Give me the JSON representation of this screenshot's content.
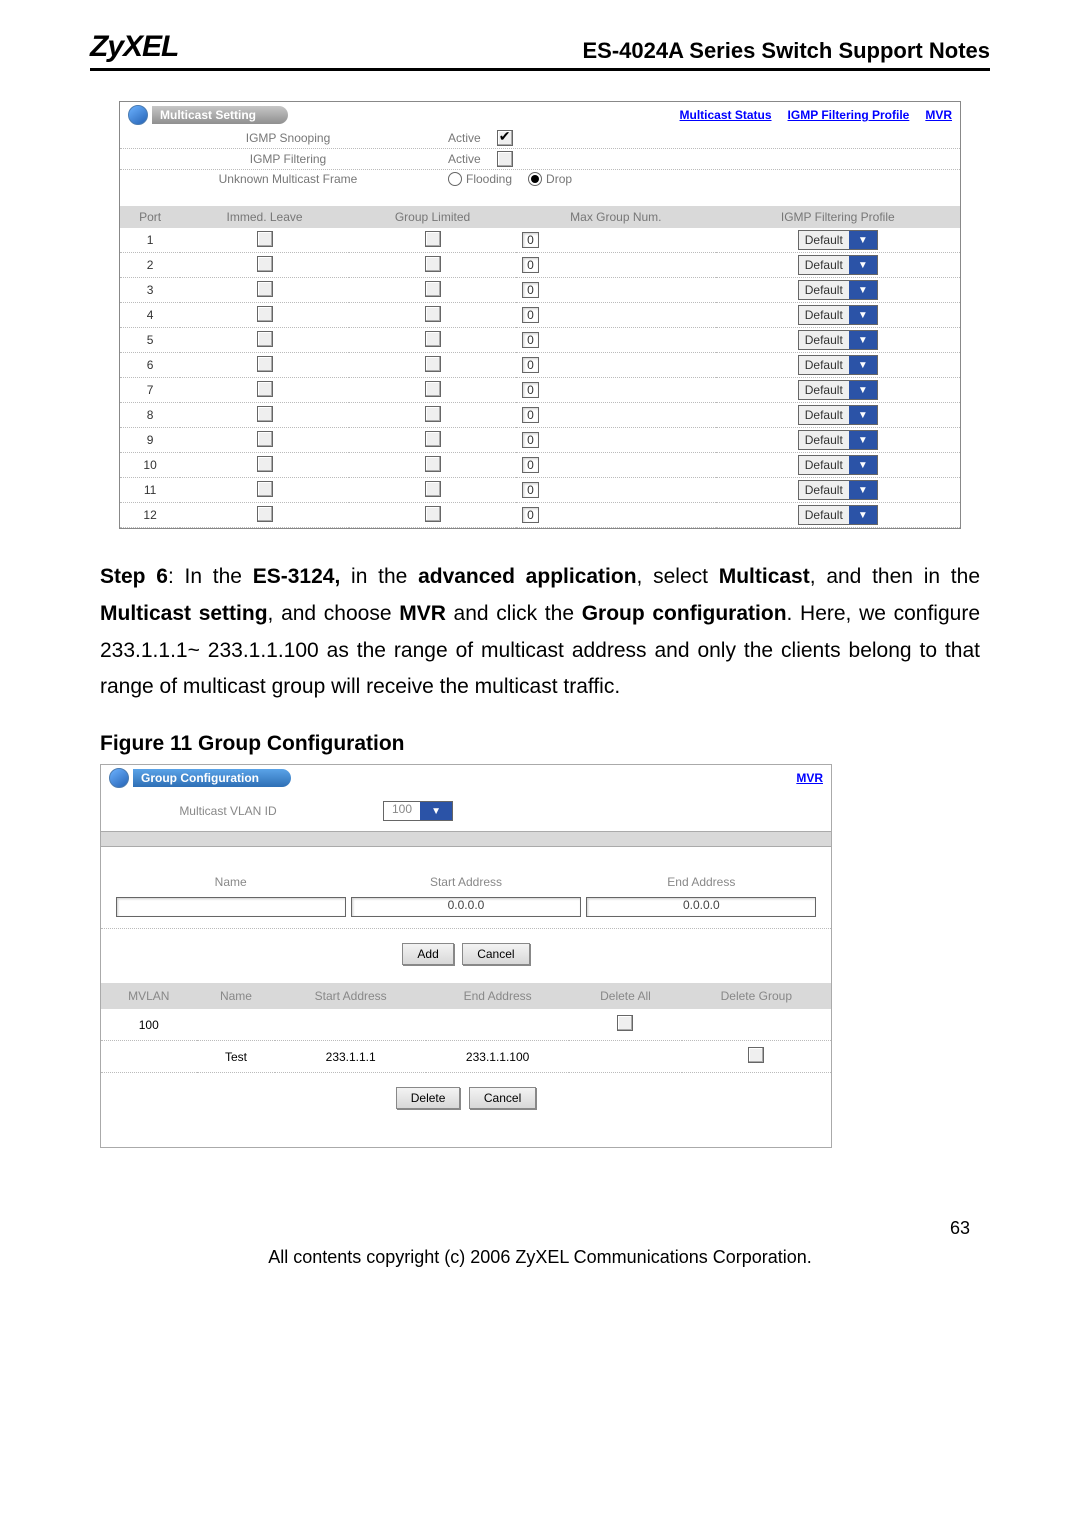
{
  "header": {
    "brand": "ZyXEL",
    "title": "ES-4024A Series Switch Support Notes"
  },
  "panel1": {
    "title": "Multicast Setting",
    "links": {
      "status": "Multicast Status",
      "profile": "IGMP Filtering Profile",
      "mvr": "MVR"
    },
    "rows": {
      "igmp_snooping": {
        "label": "IGMP Snooping",
        "field": "Active"
      },
      "igmp_filtering": {
        "label": "IGMP Filtering",
        "field": "Active"
      },
      "unknown_frame": {
        "label": "Unknown Multicast Frame",
        "opt1": "Flooding",
        "opt2": "Drop"
      }
    },
    "table": {
      "headers": {
        "port": "Port",
        "immed": "Immed. Leave",
        "group": "Group Limited",
        "max": "Max Group Num.",
        "profile": "IGMP Filtering Profile"
      },
      "rows": [
        {
          "port": "1",
          "max": "0",
          "profile": "Default"
        },
        {
          "port": "2",
          "max": "0",
          "profile": "Default"
        },
        {
          "port": "3",
          "max": "0",
          "profile": "Default"
        },
        {
          "port": "4",
          "max": "0",
          "profile": "Default"
        },
        {
          "port": "5",
          "max": "0",
          "profile": "Default"
        },
        {
          "port": "6",
          "max": "0",
          "profile": "Default"
        },
        {
          "port": "7",
          "max": "0",
          "profile": "Default"
        },
        {
          "port": "8",
          "max": "0",
          "profile": "Default"
        },
        {
          "port": "9",
          "max": "0",
          "profile": "Default"
        },
        {
          "port": "10",
          "max": "0",
          "profile": "Default"
        },
        {
          "port": "11",
          "max": "0",
          "profile": "Default"
        },
        {
          "port": "12",
          "max": "0",
          "profile": "Default"
        }
      ]
    }
  },
  "para": "Step 6: In the ES-3124, in the advanced application, select Multicast, and then in the Multicast setting, and choose MVR and click the Group configuration. Here, we configure 233.1.1.1~ 233.1.1.100 as the range of multicast address and only the clients belong to that range of multicast group will receive the multicast traffic.",
  "figcaption": "Figure 11 Group Configuration",
  "panel2": {
    "title": "Group Configuration",
    "mvr": "MVR",
    "vlan_label": "Multicast VLAN ID",
    "vlan_value": "100",
    "row2": {
      "name": "Name",
      "start": "Start Address",
      "end": "End Address",
      "start_v": "0.0.0.0",
      "end_v": "0.0.0.0",
      "name_v": ""
    },
    "btns": {
      "add": "Add",
      "cancel": "Cancel",
      "delete": "Delete"
    },
    "dtable": {
      "headers": {
        "mvlan": "MVLAN",
        "name": "Name",
        "start": "Start Address",
        "end": "End Address",
        "delall": "Delete All",
        "delgrp": "Delete Group"
      },
      "rows": [
        {
          "mvlan": "100",
          "name": "",
          "start": "",
          "end": "",
          "del": false
        },
        {
          "mvlan": "",
          "name": "Test",
          "start": "233.1.1.1",
          "end": "233.1.1.100",
          "del": false
        }
      ]
    }
  },
  "footer": {
    "page": "63",
    "copy": "All contents copyright (c) 2006 ZyXEL Communications Corporation."
  }
}
